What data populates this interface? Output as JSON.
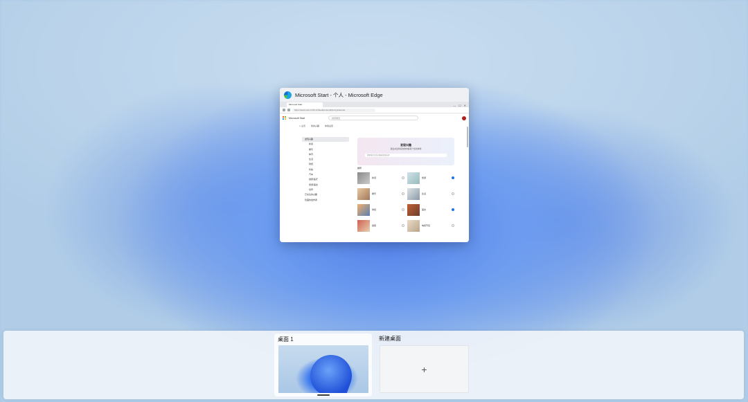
{
  "window": {
    "title": "Microsoft Start - 个人 - Microsoft Edge",
    "app_icon": "edge-icon",
    "browser": {
      "tab_label": "Microsoft Start",
      "address": "https://www.msn.cn/zh-cn/feed/personalize/myinterests",
      "window_controls": [
        "—",
        "☐",
        "✕"
      ],
      "site_name": "Microsoft Start",
      "search_placeholder": "搜索网页",
      "breadcrumb": [
        "∞ 主页",
        "我的兴趣",
        "体验设置"
      ],
      "left_nav": [
        "发现兴趣",
        "新闻",
        "娱乐",
        "体育",
        "生活",
        "财经",
        "科技",
        "汽车",
        "健康/医疗",
        "旅游/美食",
        "世界",
        "已关注的兴趣",
        "隐藏的发布者"
      ],
      "panel_title": "发现兴趣",
      "panel_subtitle": "通过关注你喜欢的内容来个性化体验",
      "panel_search_placeholder": "搜索要关注的兴趣或者发布者",
      "section_label": "推荐",
      "cards": [
        {
          "label": "新闻",
          "followed": false
        },
        {
          "label": "旅游",
          "followed": true
        },
        {
          "label": "娱乐",
          "followed": false
        },
        {
          "label": "生活",
          "followed": false
        },
        {
          "label": "财经",
          "followed": false
        },
        {
          "label": "美食",
          "followed": true
        },
        {
          "label": "健康",
          "followed": false
        },
        {
          "label": "电视节目",
          "followed": false
        }
      ]
    }
  },
  "desktops": [
    {
      "label": "桌面 1",
      "active": true
    },
    {
      "label": "新建桌面",
      "icon": "+"
    }
  ]
}
